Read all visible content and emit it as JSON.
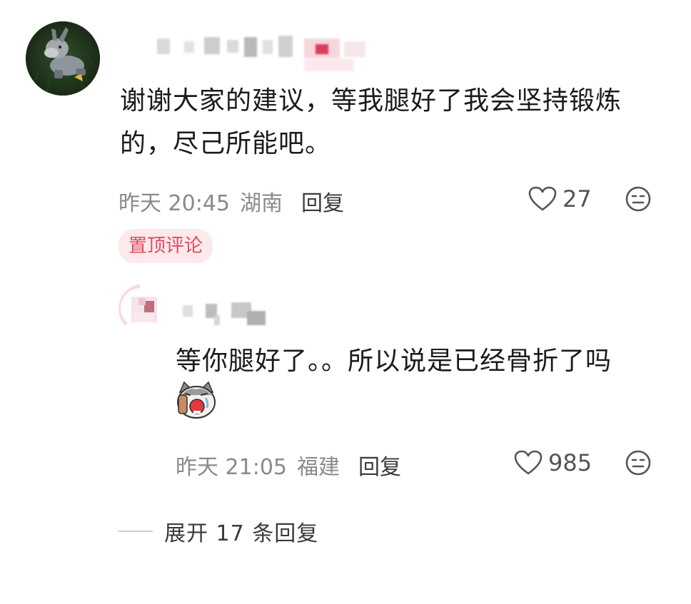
{
  "comment": {
    "text": "谢谢大家的建议，等我腿好了我会坚持锻炼的，尽己所能吧。",
    "time": "昨天 20:45",
    "region": "湖南",
    "reply_label": "回复",
    "likes": "27",
    "pinned_label": "置顶评论",
    "avatar_icon": "donkey-plush-photo-avatar"
  },
  "sub_reply": {
    "text": "等你腿好了。。所以说是已经骨折了吗",
    "emoji_icon": "crying-cat-sticker",
    "time": "昨天 21:05",
    "region": "福建",
    "reply_label": "回复",
    "likes": "985"
  },
  "expand": {
    "label": "展开 17 条回复"
  },
  "icons": {
    "like": "heart-outline-icon",
    "reaction": "meh-face-icon"
  },
  "colors": {
    "pinned_text": "#e04a62",
    "pinned_bg": "#fbe9ec",
    "meta_gray": "#8a8a8a"
  }
}
